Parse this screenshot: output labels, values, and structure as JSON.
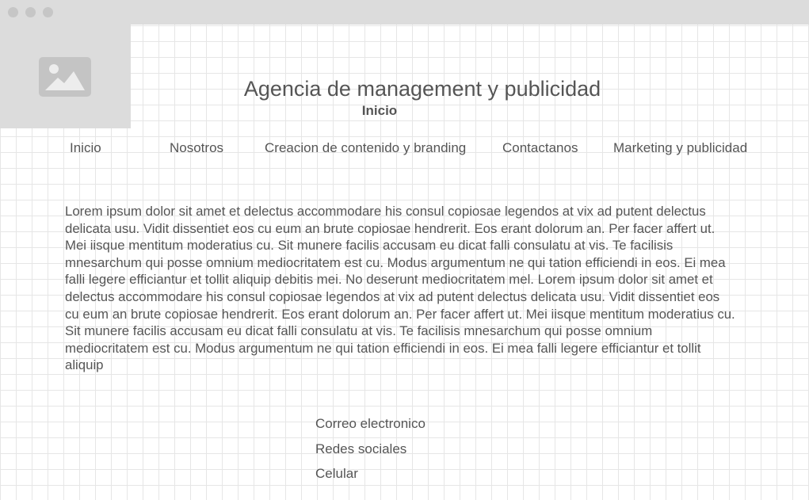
{
  "header": {
    "title": "Agencia de management y publicidad",
    "current_page": "Inicio"
  },
  "logo": {
    "icon": "image-placeholder-icon"
  },
  "nav": {
    "items": [
      {
        "label": "Inicio"
      },
      {
        "label": "Nosotros"
      },
      {
        "label": "Creacion de contenido y branding"
      },
      {
        "label": "Contactanos"
      },
      {
        "label": "Marketing y publicidad"
      }
    ]
  },
  "main": {
    "body_text": "Lorem ipsum dolor sit amet et delectus accommodare his consul copiosae legendos at vix ad putent delectus delicata usu. Vidit dissentiet eos cu eum an brute copiosae hendrerit. Eos erant dolorum an. Per facer affert ut. Mei iisque mentitum moderatius cu. Sit munere facilis accusam eu dicat falli consulatu at vis. Te facilisis mnesarchum qui posse omnium mediocritatem est cu. Modus argumentum ne qui tation efficiendi in eos. Ei mea falli legere efficiantur et tollit aliquip debitis mei. No deserunt mediocritatem mel. Lorem ipsum dolor sit amet et delectus accommodare his consul copiosae legendos at vix ad putent delectus delicata usu. Vidit dissentiet eos cu eum an brute copiosae hendrerit. Eos erant dolorum an. Per facer affert ut. Mei iisque mentitum moderatius cu. Sit munere facilis accusam eu dicat falli consulatu at vis. Te facilisis mnesarchum qui posse omnium mediocritatem est cu. Modus argumentum ne qui tation efficiendi in eos. Ei mea falli legere efficiantur et tollit aliquip"
  },
  "footer": {
    "links": [
      {
        "label": "Correo electronico"
      },
      {
        "label": "Redes sociales"
      },
      {
        "label": "Celular"
      }
    ]
  },
  "colors": {
    "text": "#555555",
    "placeholder_bg": "#dcdcdc",
    "grid_line": "#e6e6e6"
  }
}
